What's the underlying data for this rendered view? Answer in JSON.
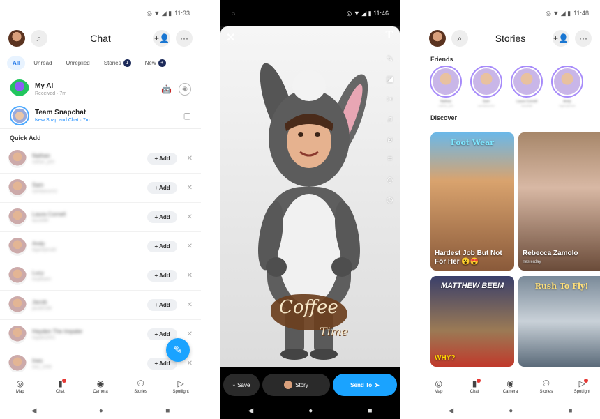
{
  "chat": {
    "status_time": "11:33",
    "title": "Chat",
    "filters": [
      {
        "label": "All"
      },
      {
        "label": "Unread"
      },
      {
        "label": "Unreplied"
      },
      {
        "label": "Stories",
        "badge": "1"
      },
      {
        "label": "New"
      }
    ],
    "my_ai": {
      "name": "My AI",
      "sub": "Received · 7m"
    },
    "team": {
      "name": "Team Snapchat",
      "sub": "New Snap and Chat · 7m"
    },
    "quick_add_title": "Quick Add",
    "quick_add": [
      {
        "name": "Nathan",
        "sub": "nathan_p03"
      },
      {
        "name": "Sam",
        "sub": "samlawson11"
      },
      {
        "name": "Laura Cornell",
        "sub": "laura088"
      },
      {
        "name": "Andy",
        "sub": "bigandyhudd"
      },
      {
        "name": "Lucy",
        "sub": "lucybeann"
      },
      {
        "name": "Jacob",
        "sub": "jacob0198"
      },
      {
        "name": "Hayden The Impaler",
        "sub": "hayden2001"
      },
      {
        "name": "Ines",
        "sub": "ines_1008"
      }
    ],
    "add_label": "+ Add",
    "remove_glyph": "✕"
  },
  "nav": [
    {
      "label": "Map",
      "icon": "◎"
    },
    {
      "label": "Chat",
      "icon": "▮"
    },
    {
      "label": "Camera",
      "icon": "◉"
    },
    {
      "label": "Stories",
      "icon": "⚇"
    },
    {
      "label": "Spotlight",
      "icon": "▷"
    }
  ],
  "snap": {
    "status_time": "11:46",
    "close_glyph": "✕",
    "text_tool": "T",
    "sticker_line1": "Coffee",
    "sticker_line2": "Time",
    "save_label": "Save",
    "story_label": "Story",
    "send_label": "Send To"
  },
  "stories": {
    "status_time": "11:48",
    "title": "Stories",
    "friends_title": "Friends",
    "friends": [
      {
        "name": "Nathan",
        "sub": "nathan_p03"
      },
      {
        "name": "Sam",
        "sub": "samlawson11"
      },
      {
        "name": "Laura Cornell",
        "sub": "laura088"
      },
      {
        "name": "Andy",
        "sub": "bigandyhudd"
      }
    ],
    "discover_title": "Discover",
    "cards": [
      {
        "top": "Foot Wear",
        "title": "Hardest Job But Not For Her 😮😍"
      },
      {
        "top": "",
        "title": "Rebecca Zamolo",
        "sub": "Yesterday"
      },
      {
        "top": "MATTHEW BEEM",
        "title": "WHY?"
      },
      {
        "top": "Rush To Fly!",
        "title": ""
      }
    ]
  },
  "colors": {
    "accent": "#1aa3ff",
    "badge": "#1d2b5a",
    "ring": "#a78bfa"
  }
}
